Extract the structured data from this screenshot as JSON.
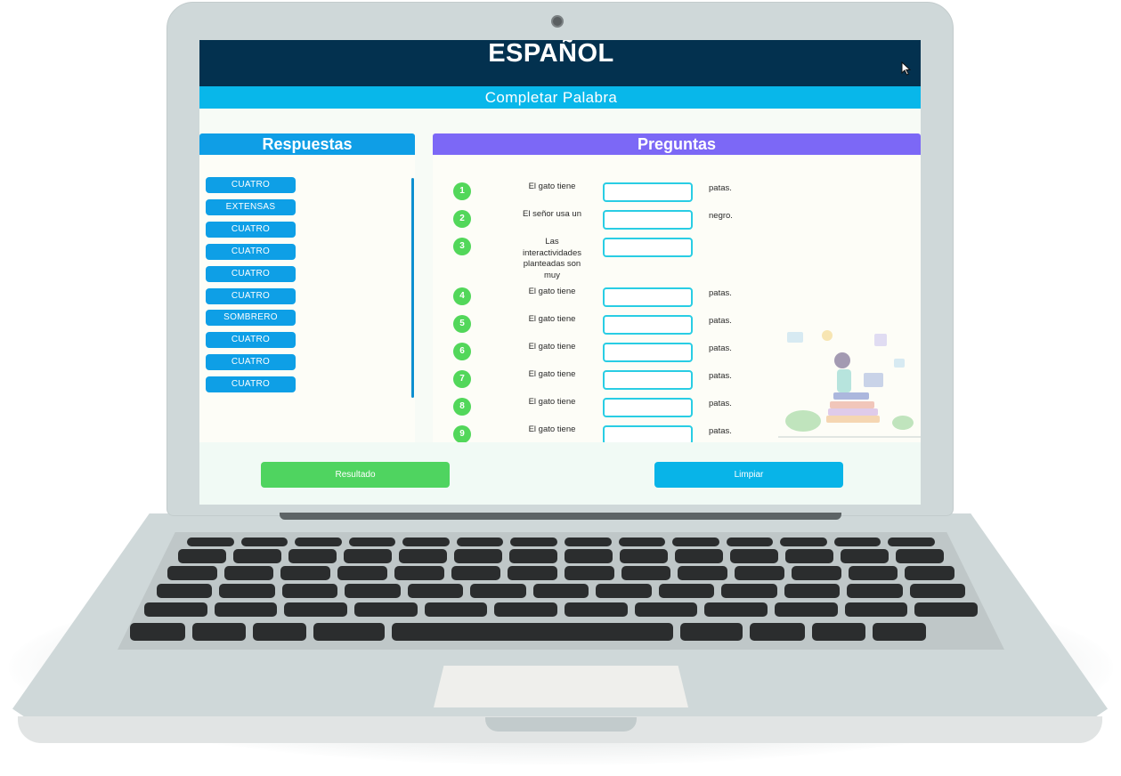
{
  "header": {
    "title": "ESPAÑOL",
    "subtitle": "Completar Palabra"
  },
  "panels": {
    "answers_title": "Respuestas",
    "questions_title": "Preguntas"
  },
  "answers": [
    "CUATRO",
    "EXTENSAS",
    "CUATRO",
    "CUATRO",
    "CUATRO",
    "CUATRO",
    "SOMBRERO",
    "CUATRO",
    "CUATRO",
    "CUATRO"
  ],
  "questions": [
    {
      "num": "1",
      "text": "El gato tiene",
      "suffix": "patas.",
      "value": ""
    },
    {
      "num": "2",
      "text": "El señor usa un",
      "suffix": "negro.",
      "value": ""
    },
    {
      "num": "3",
      "text": "Las interactividades planteadas son muy",
      "suffix": "",
      "value": ""
    },
    {
      "num": "4",
      "text": "El gato tiene",
      "suffix": "patas.",
      "value": ""
    },
    {
      "num": "5",
      "text": "El gato tiene",
      "suffix": "patas.",
      "value": ""
    },
    {
      "num": "6",
      "text": "El gato tiene",
      "suffix": "patas.",
      "value": ""
    },
    {
      "num": "7",
      "text": "El gato tiene",
      "suffix": "patas.",
      "value": ""
    },
    {
      "num": "8",
      "text": "El gato tiene",
      "suffix": "patas.",
      "value": ""
    },
    {
      "num": "9",
      "text": "El gato tiene",
      "suffix": "patas.",
      "value": ""
    }
  ],
  "buttons": {
    "result": "Resultado",
    "clear": "Limpiar"
  },
  "colors": {
    "header_bg": "#03314f",
    "subheader_bg": "#08b7ea",
    "answers_head": "#0f9ee6",
    "questions_head": "#7c68f6",
    "number_badge": "#52d75a",
    "result_button": "#4fd460",
    "clear_button": "#08b4e8"
  },
  "icons": {
    "cursor": "mouse-pointer-icon",
    "camera": "webcam-icon"
  }
}
